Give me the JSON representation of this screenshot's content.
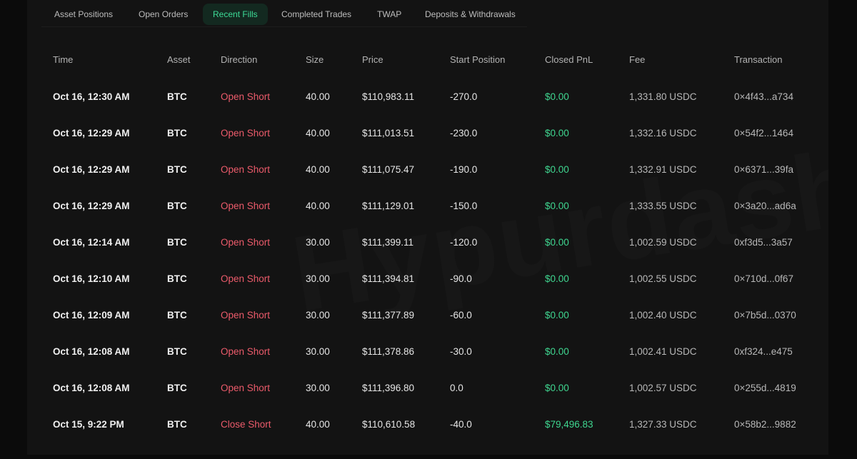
{
  "tabs": [
    {
      "label": "Asset Positions"
    },
    {
      "label": "Open Orders"
    },
    {
      "label": "Recent Fills",
      "active": true
    },
    {
      "label": "Completed Trades"
    },
    {
      "label": "TWAP"
    },
    {
      "label": "Deposits & Withdrawals"
    }
  ],
  "watermark": "Hypurdash",
  "colors": {
    "accent": "#3ddc97",
    "short": "#ec5b6b",
    "pnl_positive": "#3fd690",
    "background": "#131313"
  },
  "table": {
    "columns": [
      "Time",
      "Asset",
      "Direction",
      "Size",
      "Price",
      "Start Position",
      "Closed PnL",
      "Fee",
      "Transaction"
    ],
    "rows": [
      {
        "time": "Oct 16, 12:30 AM",
        "asset": "BTC",
        "direction": "Open Short",
        "size": "40.00",
        "price": "$110,983.11",
        "start_position": "-270.0",
        "closed_pnl": "$0.00",
        "fee": "1,331.80 USDC",
        "transaction": "0×4f43...a734"
      },
      {
        "time": "Oct 16, 12:29 AM",
        "asset": "BTC",
        "direction": "Open Short",
        "size": "40.00",
        "price": "$111,013.51",
        "start_position": "-230.0",
        "closed_pnl": "$0.00",
        "fee": "1,332.16 USDC",
        "transaction": "0×54f2...1464"
      },
      {
        "time": "Oct 16, 12:29 AM",
        "asset": "BTC",
        "direction": "Open Short",
        "size": "40.00",
        "price": "$111,075.47",
        "start_position": "-190.0",
        "closed_pnl": "$0.00",
        "fee": "1,332.91 USDC",
        "transaction": "0×6371...39fa"
      },
      {
        "time": "Oct 16, 12:29 AM",
        "asset": "BTC",
        "direction": "Open Short",
        "size": "40.00",
        "price": "$111,129.01",
        "start_position": "-150.0",
        "closed_pnl": "$0.00",
        "fee": "1,333.55 USDC",
        "transaction": "0×3a20...ad6a"
      },
      {
        "time": "Oct 16, 12:14 AM",
        "asset": "BTC",
        "direction": "Open Short",
        "size": "30.00",
        "price": "$111,399.11",
        "start_position": "-120.0",
        "closed_pnl": "$0.00",
        "fee": "1,002.59 USDC",
        "transaction": "0xf3d5...3a57"
      },
      {
        "time": "Oct 16, 12:10 AM",
        "asset": "BTC",
        "direction": "Open Short",
        "size": "30.00",
        "price": "$111,394.81",
        "start_position": "-90.0",
        "closed_pnl": "$0.00",
        "fee": "1,002.55 USDC",
        "transaction": "0×710d...0f67"
      },
      {
        "time": "Oct 16, 12:09 AM",
        "asset": "BTC",
        "direction": "Open Short",
        "size": "30.00",
        "price": "$111,377.89",
        "start_position": "-60.0",
        "closed_pnl": "$0.00",
        "fee": "1,002.40 USDC",
        "transaction": "0×7b5d...0370"
      },
      {
        "time": "Oct 16, 12:08 AM",
        "asset": "BTC",
        "direction": "Open Short",
        "size": "30.00",
        "price": "$111,378.86",
        "start_position": "-30.0",
        "closed_pnl": "$0.00",
        "fee": "1,002.41 USDC",
        "transaction": "0xf324...e475"
      },
      {
        "time": "Oct 16, 12:08 AM",
        "asset": "BTC",
        "direction": "Open Short",
        "size": "30.00",
        "price": "$111,396.80",
        "start_position": "0.0",
        "closed_pnl": "$0.00",
        "fee": "1,002.57 USDC",
        "transaction": "0×255d...4819"
      },
      {
        "time": "Oct 15, 9:22 PM",
        "asset": "BTC",
        "direction": "Close Short",
        "size": "40.00",
        "price": "$110,610.58",
        "start_position": "-40.0",
        "closed_pnl": "$79,496.83",
        "fee": "1,327.33 USDC",
        "transaction": "0×58b2...9882"
      }
    ]
  }
}
